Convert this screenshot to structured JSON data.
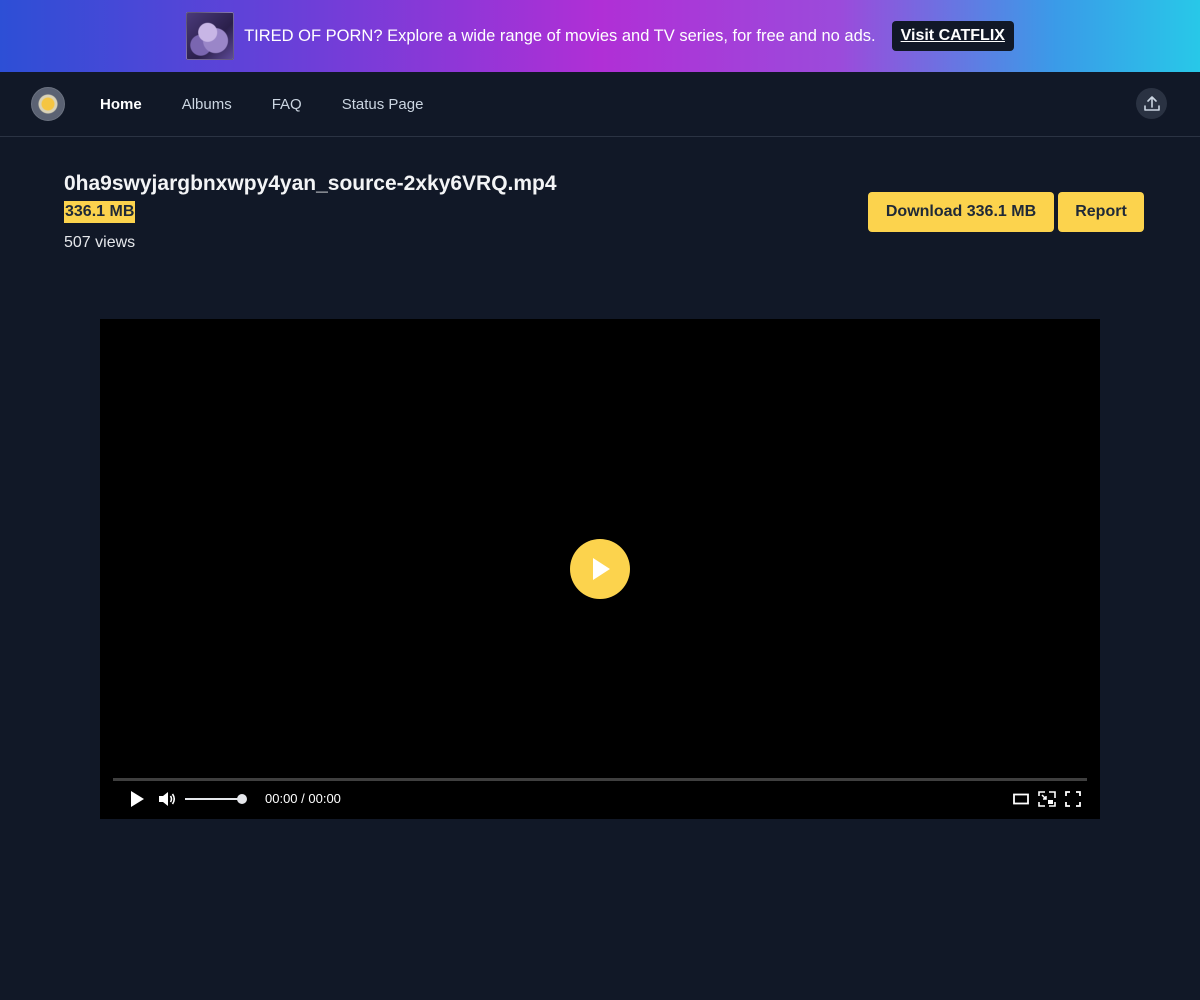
{
  "banner": {
    "text": "TIRED OF PORN? Explore a wide range of movies and TV series, for free and no ads.",
    "button_label": "Visit CATFLIX"
  },
  "nav": {
    "links": [
      {
        "label": "Home",
        "active": true
      },
      {
        "label": "Albums"
      },
      {
        "label": "FAQ"
      },
      {
        "label": "Status Page"
      }
    ]
  },
  "file": {
    "name": "0ha9swyjargbnxwpy4yan_source-2xky6VRQ.mp4",
    "size": "336.1 MB",
    "views": "507 views"
  },
  "actions": {
    "download_label": "Download 336.1 MB",
    "report_label": "Report"
  },
  "player": {
    "time": "00:00 / 00:00",
    "progress": 0,
    "volume": 1.0
  },
  "icons": {
    "upload": "upload-icon",
    "play": "play-icon",
    "volume": "volume-icon",
    "theater": "theater-mode-icon",
    "pip": "picture-in-picture-icon",
    "fullscreen": "fullscreen-icon"
  },
  "colors": {
    "accent": "#fcd34d",
    "background": "#111827",
    "player_bg": "#000000"
  }
}
